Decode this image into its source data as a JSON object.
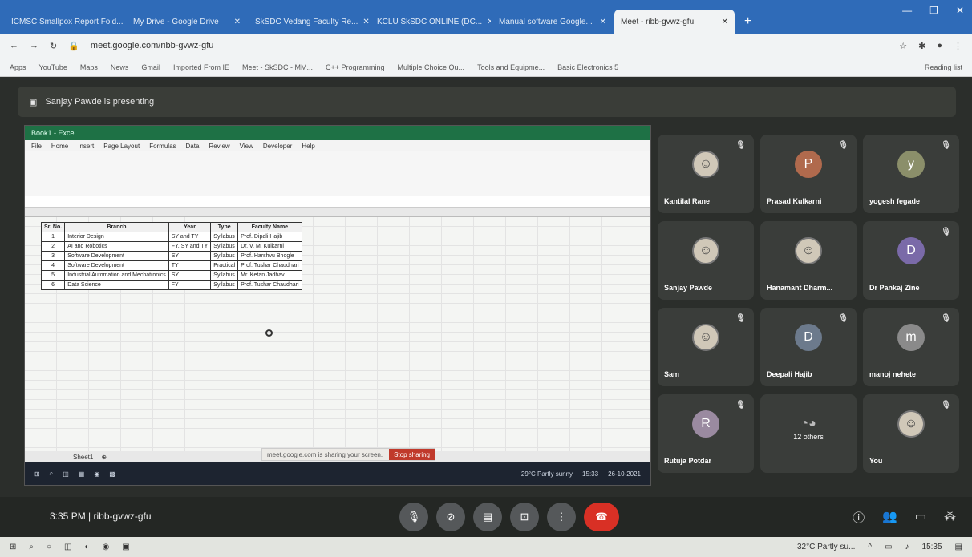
{
  "browser": {
    "tabs": [
      {
        "label": "ICMSC Smallpox Report Fold..."
      },
      {
        "label": "My Drive - Google Drive"
      },
      {
        "label": "SkSDC Vedang Faculty Re..."
      },
      {
        "label": "KCLU SkSDC ONLINE (DC..."
      },
      {
        "label": "Manual software Google..."
      },
      {
        "label": "Meet - ribb-gvwz-gfu",
        "active": true
      }
    ],
    "url": "meet.google.com/ribb-gvwz-gfu",
    "bookmarks": [
      "Apps",
      "YouTube",
      "Maps",
      "News",
      "Gmail",
      "Imported From IE",
      "Meet - SkSDC - MM...",
      "C++ Programming",
      "Multiple Choice Qu...",
      "Tools and Equipme...",
      "Basic Electronics 5"
    ],
    "reading_list": "Reading list"
  },
  "meet": {
    "presenter_text": "Sanjay Pawde is presenting",
    "meeting_time": "3:35 PM",
    "meeting_code": "ribb-gvwz-gfu",
    "separator": "|"
  },
  "excel": {
    "title": "Book1 - Excel",
    "ribbon_tabs": [
      "File",
      "Home",
      "Insert",
      "Page Layout",
      "Formulas",
      "Data",
      "Review",
      "View",
      "Developer",
      "Help"
    ],
    "headers": [
      "Sr. No.",
      "Branch",
      "Year",
      "Type",
      "Faculty Name"
    ],
    "rows": [
      [
        "1",
        "Interior Design",
        "SY and TY",
        "Syllabus",
        "Prof. Dipali Hajib"
      ],
      [
        "2",
        "AI and Robotics",
        "FY, SY and TY",
        "Syllabus",
        "Dr. V. M. Kulkarni"
      ],
      [
        "3",
        "Software Development",
        "SY",
        "Syllabus",
        "Prof. Harshvu Bhogle"
      ],
      [
        "4",
        "Software Development",
        "TY",
        "Practical",
        "Prof. Tushar Chaudhari"
      ],
      [
        "5",
        "Industrial Automation and Mechatronics",
        "SY",
        "Syllabus",
        "Mr. Ketan Jadhav"
      ],
      [
        "6",
        "Data Science",
        "FY",
        "Syllabus",
        "Prof. Tushar Chaudhari"
      ]
    ],
    "sheet_tab": "Sheet1",
    "share_msg": "meet.google.com is sharing your screen.",
    "stop_sharing": "Stop sharing",
    "inner_weather": "29°C Partly sunny",
    "inner_time": "15:33",
    "inner_date": "26-10-2021"
  },
  "participants": [
    {
      "name": "Kantilal Rane",
      "type": "photo",
      "muted": true
    },
    {
      "name": "Prasad Kulkarni",
      "initial": "P",
      "color": "#b06a4d",
      "muted": true
    },
    {
      "name": "yogesh fegade",
      "initial": "y",
      "color": "#8b8f6a",
      "muted": true
    },
    {
      "name": "Sanjay Pawde",
      "type": "photo",
      "muted": false
    },
    {
      "name": "Hanamant Dharm...",
      "type": "photo",
      "muted": false
    },
    {
      "name": "Dr Pankaj Zine",
      "initial": "D",
      "color": "#7a6aa8",
      "muted": true
    },
    {
      "name": "Sam",
      "type": "photo",
      "muted": true
    },
    {
      "name": "Deepali Hajib",
      "initial": "D",
      "color": "#6c7a8c",
      "muted": true
    },
    {
      "name": "manoj nehete",
      "initial": "m",
      "color": "#8a8a8a",
      "muted": true
    },
    {
      "name": "Rutuja Potdar",
      "initial": "R",
      "color": "#9a8aa0",
      "muted": true
    },
    {
      "name": "12 others",
      "type": "others",
      "muted": false
    },
    {
      "name": "You",
      "type": "photo",
      "muted": true
    }
  ],
  "taskbar": {
    "weather": "32°C Partly su...",
    "time": "15:35"
  }
}
